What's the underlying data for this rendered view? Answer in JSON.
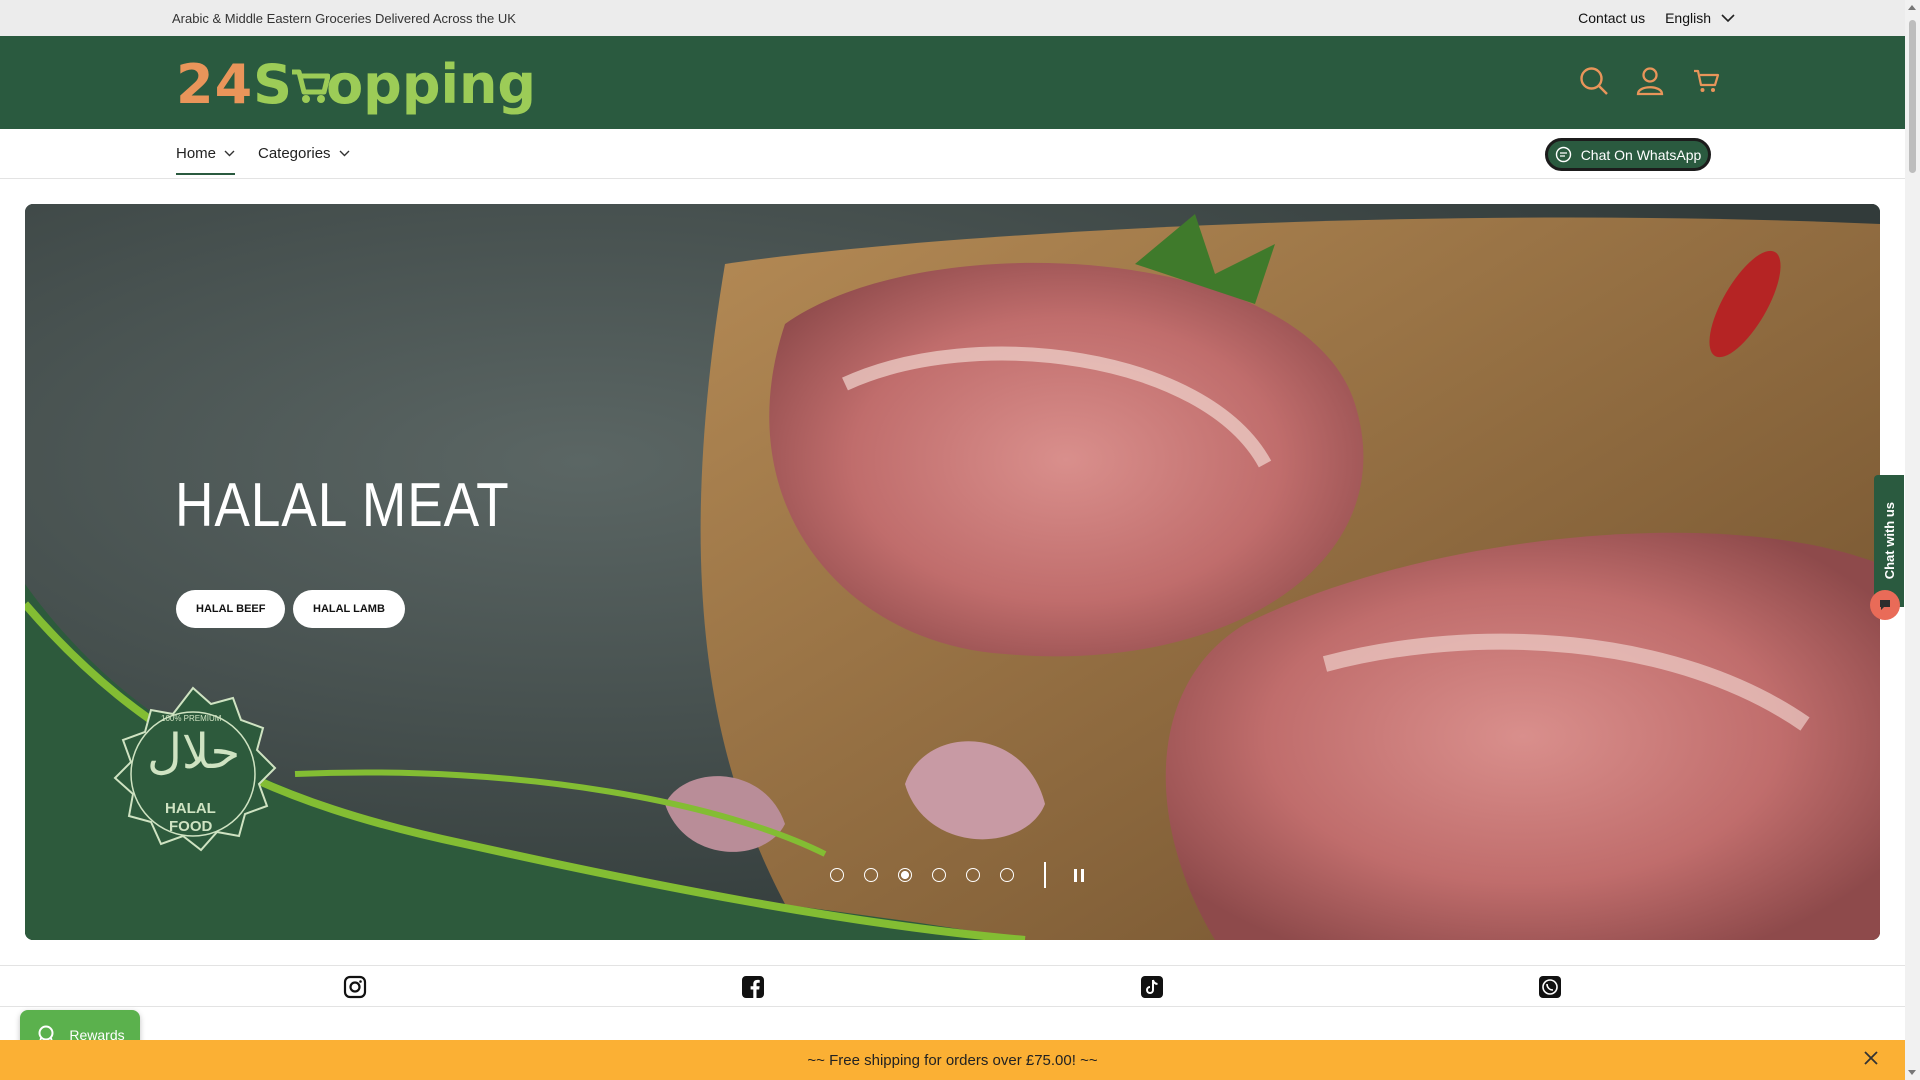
{
  "topbar": {
    "tagline": "Arabic & Middle Eastern Groceries Delivered Across the UK",
    "contact": "Contact us",
    "language": "English"
  },
  "header": {
    "logo_digits": "24",
    "logo_s": "S",
    "logo_rest": "opping",
    "icons": [
      "search-icon",
      "account-icon",
      "cart-icon"
    ]
  },
  "nav": {
    "items": [
      {
        "label": "Home"
      },
      {
        "label": "Categories"
      }
    ],
    "whatsapp_label": "Chat On WhatsApp"
  },
  "hero": {
    "title": "HALAL MEAT",
    "buttons": [
      {
        "label": "HALAL BEEF"
      },
      {
        "label": "HALAL LAMB"
      }
    ],
    "badge": {
      "top": "100% PREMIUM",
      "arabic": "حلال",
      "line1": "HALAL",
      "line2": "FOOD"
    },
    "slides_total": 6,
    "active_slide": 3
  },
  "chat_widget": {
    "label": "Chat with us"
  },
  "social": [
    "instagram-icon",
    "facebook-icon",
    "tiktok-icon",
    "whatsapp-icon"
  ],
  "rewards": {
    "label": "Rewards"
  },
  "shipping_bar": {
    "text": "~~ Free shipping for orders over £75.00! ~~"
  },
  "colors": {
    "brand_green": "#2a5a3f",
    "logo_orange": "#e9955a",
    "logo_green": "#9ccc57",
    "shipping_yellow": "#fbb034",
    "rewards_green": "#5bb14d"
  }
}
